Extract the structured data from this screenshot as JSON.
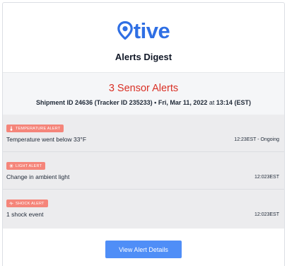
{
  "brand": {
    "logo_text": "tive",
    "accent_color": "#2f6fe4",
    "logo_icon": "location-pin-icon"
  },
  "header": {
    "title": "Alerts Digest"
  },
  "summary": {
    "alerts_count": "3 Sensor Alerts",
    "shipment_id": "Shipment ID 24636 (Tracker ID 235233)",
    "separator": "•",
    "date": "Fri, Mar 11, 2022",
    "at_label": "at",
    "time": "13:14 (EST)",
    "alert_color": "#d93025"
  },
  "alerts": [
    {
      "badge": "TEMPERATURE ALERT",
      "icon": "thermometer-icon",
      "text": "Temperature went below 33°F",
      "time": "12:23EST - Ongoing"
    },
    {
      "badge": "LIGHT ALERT",
      "icon": "light-icon",
      "text": "Change in ambient light",
      "time": "12:023EST"
    },
    {
      "badge": "SHOCK ALERT",
      "icon": "shock-icon",
      "text": "1 shock event",
      "time": "12:023EST"
    }
  ],
  "cta": {
    "label": "View Alert Details"
  }
}
